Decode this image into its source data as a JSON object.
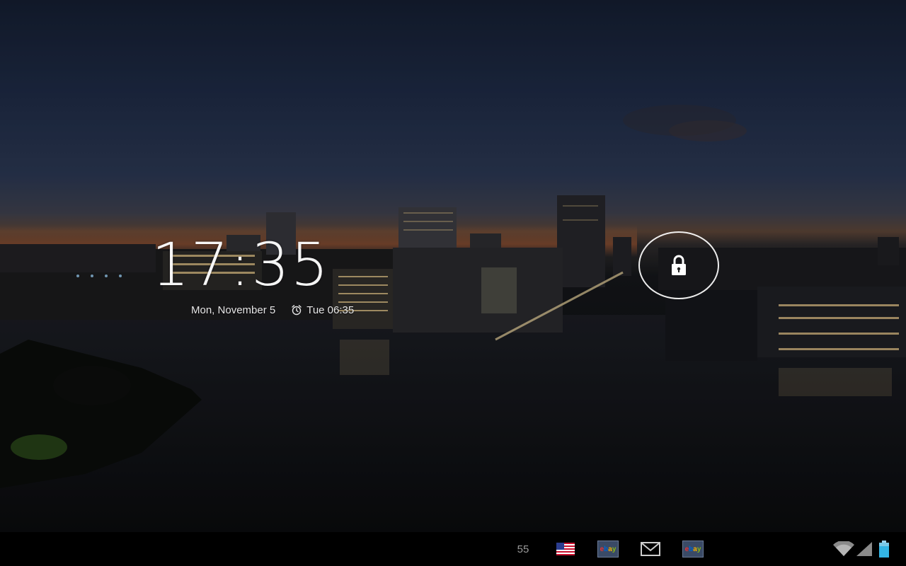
{
  "lockscreen": {
    "time": "17:35",
    "date": "Mon, November 5",
    "alarm": "Tue 06:35"
  },
  "statusbar": {
    "notification_count": "55",
    "notification_icons": [
      "flag-us-icon",
      "ebay-icon",
      "gmail-icon",
      "ebay-icon"
    ],
    "system_icons": [
      "wifi-icon",
      "cell-signal-icon",
      "battery-icon"
    ]
  },
  "colors": {
    "lock_ring": "#ffffff",
    "statusbar_bg": "#000000",
    "text_secondary": "#9a9a9a"
  }
}
